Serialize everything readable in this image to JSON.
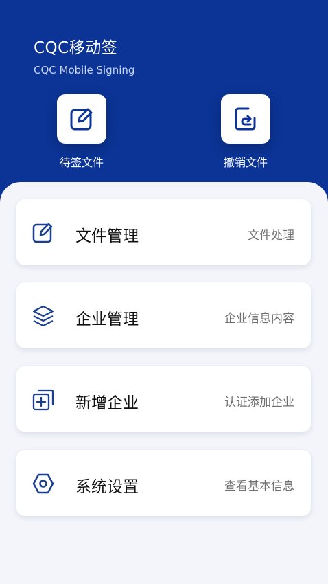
{
  "header": {
    "title": "CQC移动签",
    "subtitle": "CQC Mobile Signing",
    "quick_actions": [
      {
        "label": "待签文件",
        "icon": "edit-icon"
      },
      {
        "label": "撤销文件",
        "icon": "revoke-icon"
      }
    ],
    "bg_color": "#0b3496"
  },
  "menu": [
    {
      "title": "文件管理",
      "desc": "文件处理",
      "icon": "edit-icon"
    },
    {
      "title": "企业管理",
      "desc": "企业信息内容",
      "icon": "layers-icon"
    },
    {
      "title": "新增企业",
      "desc": "认证添加企业",
      "icon": "add-copy-icon"
    },
    {
      "title": "系统设置",
      "desc": "查看基本信息",
      "icon": "hexagon-settings-icon"
    }
  ],
  "colors": {
    "accent": "#0b3496",
    "icon": "#1b3f8f"
  }
}
